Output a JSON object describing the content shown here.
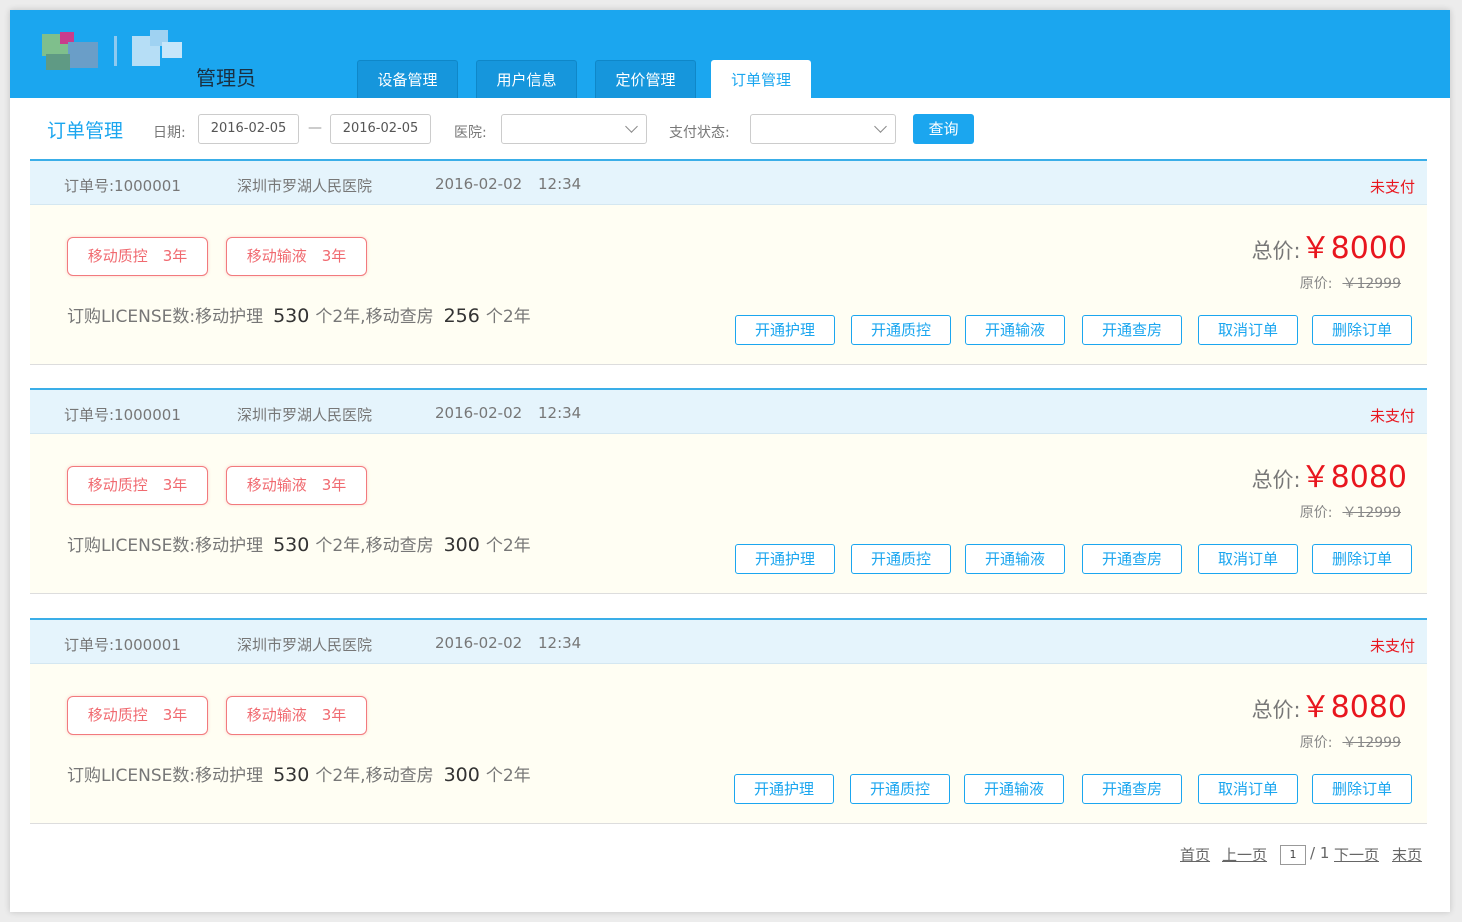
{
  "header": {
    "admin_label": "管理员",
    "tabs": [
      {
        "label": "设备管理",
        "active": false
      },
      {
        "label": "用户信息",
        "active": false
      },
      {
        "label": "定价管理",
        "active": false
      },
      {
        "label": "订单管理",
        "active": true
      }
    ]
  },
  "filters": {
    "page_title": "订单管理",
    "date_label": "日期:",
    "date_from": "2016-02-05",
    "date_sep": "—",
    "date_to": "2016-02-05",
    "hospital_label": "医院:",
    "hospital_value": "",
    "pay_status_label": "支付状态:",
    "pay_status_value": "",
    "query_button": "查询"
  },
  "orders": [
    {
      "order_no": "订单号:1000001",
      "hospital": "深圳市罗湖人民医院",
      "date": "2016-02-02",
      "time": "12:34",
      "status": "未支付",
      "tags": [
        "移动质控　3年",
        "移动输液　3年"
      ],
      "license_prefix": "订购LICENSE数:移动护理",
      "nursing_count": "530",
      "license_mid": "个2年,移动查房",
      "rounds_count": "256",
      "license_suffix": "个2年",
      "total_label": "总价:",
      "total_value": "￥8000",
      "orig_label": "原价:",
      "orig_value": "￥12999",
      "actions": [
        "开通护理",
        "开通质控",
        "开通输液",
        "开通查房",
        "取消订单",
        "删除订单"
      ]
    },
    {
      "order_no": "订单号:1000001",
      "hospital": "深圳市罗湖人民医院",
      "date": "2016-02-02",
      "time": "12:34",
      "status": "未支付",
      "tags": [
        "移动质控　3年",
        "移动输液　3年"
      ],
      "license_prefix": "订购LICENSE数:移动护理",
      "nursing_count": "530",
      "license_mid": "个2年,移动查房",
      "rounds_count": "300",
      "license_suffix": "个2年",
      "total_label": "总价:",
      "total_value": "￥8080",
      "orig_label": "原价:",
      "orig_value": "￥12999",
      "actions": [
        "开通护理",
        "开通质控",
        "开通输液",
        "开通查房",
        "取消订单",
        "删除订单"
      ]
    },
    {
      "order_no": "订单号:1000001",
      "hospital": "深圳市罗湖人民医院",
      "date": "2016-02-02",
      "time": "12:34",
      "status": "未支付",
      "tags": [
        "移动质控　3年",
        "移动输液　3年"
      ],
      "license_prefix": "订购LICENSE数:移动护理",
      "nursing_count": "530",
      "license_mid": "个2年,移动查房",
      "rounds_count": "300",
      "license_suffix": "个2年",
      "total_label": "总价:",
      "total_value": "￥8080",
      "orig_label": "原价:",
      "orig_value": "￥12999",
      "actions": [
        "开通护理",
        "开通质控",
        "开通输液",
        "开通查房",
        "取消订单",
        "删除订单"
      ]
    }
  ],
  "pagination": {
    "first": "首页",
    "prev": "上一页",
    "current": "1",
    "total": "/ 1",
    "next": "下一页",
    "last": "末页"
  },
  "colors": {
    "accent": "#1ba6ef",
    "price_red": "#e8161e",
    "tag_red": "#f06a70",
    "order_head_bg": "#e5f4fc",
    "order_body_bg": "#fffef3"
  }
}
